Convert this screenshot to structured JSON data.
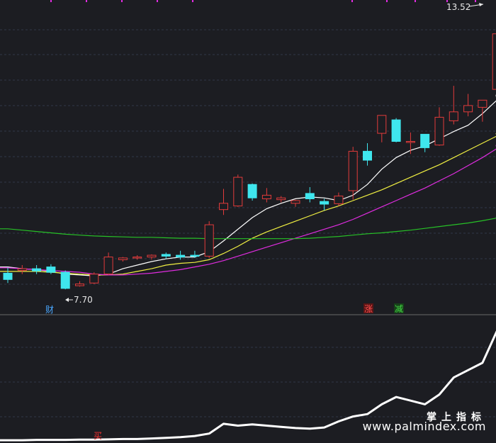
{
  "chart_data": [
    {
      "type": "candlestick",
      "title": "",
      "ylim": [
        7.2,
        14.0
      ],
      "annotations": {
        "high_label": "13.52",
        "low_label": "7.70",
        "marker_cai": "财",
        "marker_zhang": "涨",
        "marker_jian": "减"
      },
      "colors": {
        "up": "#e23b3b",
        "down": "#3fe6ee",
        "bg": "#1c1d22"
      },
      "candles": [
        {
          "o": 8.0,
          "h": 8.12,
          "l": 7.78,
          "c": 7.86
        },
        {
          "o": 8.06,
          "h": 8.18,
          "l": 7.98,
          "c": 8.1
        },
        {
          "o": 8.1,
          "h": 8.18,
          "l": 7.98,
          "c": 8.05
        },
        {
          "o": 8.14,
          "h": 8.2,
          "l": 7.98,
          "c": 8.02
        },
        {
          "o": 8.02,
          "h": 8.06,
          "l": 7.64,
          "c": 7.66
        },
        {
          "o": 7.72,
          "h": 7.82,
          "l": 7.7,
          "c": 7.76
        },
        {
          "o": 7.78,
          "h": 8.02,
          "l": 7.76,
          "c": 7.98
        },
        {
          "o": 7.98,
          "h": 8.46,
          "l": 7.96,
          "c": 8.36
        },
        {
          "o": 8.3,
          "h": 8.36,
          "l": 8.26,
          "c": 8.34
        },
        {
          "o": 8.34,
          "h": 8.4,
          "l": 8.3,
          "c": 8.36
        },
        {
          "o": 8.36,
          "h": 8.42,
          "l": 8.3,
          "c": 8.4
        },
        {
          "o": 8.42,
          "h": 8.46,
          "l": 8.32,
          "c": 8.38
        },
        {
          "o": 8.4,
          "h": 8.5,
          "l": 8.3,
          "c": 8.36
        },
        {
          "o": 8.4,
          "h": 8.5,
          "l": 8.34,
          "c": 8.38
        },
        {
          "o": 8.38,
          "h": 9.16,
          "l": 8.34,
          "c": 9.08
        },
        {
          "o": 9.42,
          "h": 9.88,
          "l": 9.3,
          "c": 9.56
        },
        {
          "o": 9.5,
          "h": 10.2,
          "l": 9.48,
          "c": 10.14
        },
        {
          "o": 9.98,
          "h": 10.0,
          "l": 9.62,
          "c": 9.68
        },
        {
          "o": 9.66,
          "h": 9.9,
          "l": 9.58,
          "c": 9.74
        },
        {
          "o": 9.64,
          "h": 9.72,
          "l": 9.58,
          "c": 9.68
        },
        {
          "o": 9.56,
          "h": 9.64,
          "l": 9.48,
          "c": 9.62
        },
        {
          "o": 9.78,
          "h": 9.92,
          "l": 9.58,
          "c": 9.66
        },
        {
          "o": 9.6,
          "h": 9.66,
          "l": 9.4,
          "c": 9.54
        },
        {
          "o": 9.55,
          "h": 9.8,
          "l": 9.5,
          "c": 9.72
        },
        {
          "o": 9.84,
          "h": 10.82,
          "l": 9.64,
          "c": 10.72
        },
        {
          "o": 10.72,
          "h": 10.9,
          "l": 10.4,
          "c": 10.52
        },
        {
          "o": 11.12,
          "h": 11.32,
          "l": 10.92,
          "c": 11.52
        },
        {
          "o": 11.42,
          "h": 11.46,
          "l": 10.92,
          "c": 10.94
        },
        {
          "o": 10.92,
          "h": 11.14,
          "l": 10.66,
          "c": 10.94
        },
        {
          "o": 11.1,
          "h": 10.92,
          "l": 10.7,
          "c": 10.8
        },
        {
          "o": 10.86,
          "h": 11.7,
          "l": 10.84,
          "c": 11.48
        },
        {
          "o": 11.4,
          "h": 12.18,
          "l": 11.32,
          "c": 11.6
        },
        {
          "o": 11.6,
          "h": 12.0,
          "l": 11.5,
          "c": 11.74
        },
        {
          "o": 11.7,
          "h": 11.86,
          "l": 11.38,
          "c": 11.86
        },
        {
          "o": 12.1,
          "h": 13.52,
          "l": 11.68,
          "c": 13.34
        }
      ],
      "ma": [
        {
          "color": "#ffffff",
          "values": [
            8.14,
            8.1,
            8.08,
            8.04,
            7.98,
            7.96,
            7.94,
            7.98,
            8.1,
            8.18,
            8.26,
            8.32,
            8.36,
            8.36,
            8.48,
            8.72,
            8.98,
            9.24,
            9.44,
            9.56,
            9.66,
            9.7,
            9.68,
            9.62,
            9.74,
            9.98,
            10.32,
            10.58,
            10.74,
            10.84,
            11.0,
            11.16,
            11.3,
            11.56,
            11.86
          ]
        },
        {
          "color": "#f1f042",
          "values": [
            8.04,
            8.04,
            8.04,
            8.02,
            8.0,
            7.98,
            7.96,
            7.96,
            7.98,
            8.04,
            8.1,
            8.18,
            8.22,
            8.24,
            8.3,
            8.44,
            8.6,
            8.78,
            8.92,
            9.04,
            9.16,
            9.28,
            9.4,
            9.5,
            9.62,
            9.74,
            9.86,
            10.0,
            10.14,
            10.28,
            10.42,
            10.58,
            10.74,
            10.9,
            11.06
          ]
        },
        {
          "color": "#e02ce0",
          "values": [
            8.12,
            8.1,
            8.08,
            8.06,
            8.04,
            8.02,
            7.98,
            7.96,
            7.96,
            7.98,
            8.0,
            8.04,
            8.08,
            8.14,
            8.2,
            8.28,
            8.38,
            8.48,
            8.58,
            8.68,
            8.78,
            8.88,
            8.98,
            9.08,
            9.2,
            9.34,
            9.48,
            9.62,
            9.76,
            9.9,
            10.06,
            10.22,
            10.4,
            10.58,
            10.78
          ]
        },
        {
          "color": "#27c127",
          "values": [
            8.99,
            8.96,
            8.93,
            8.9,
            8.87,
            8.85,
            8.83,
            8.82,
            8.81,
            8.8,
            8.8,
            8.79,
            8.78,
            8.78,
            8.77,
            8.77,
            8.77,
            8.77,
            8.77,
            8.77,
            8.77,
            8.78,
            8.8,
            8.82,
            8.85,
            8.88,
            8.9,
            8.93,
            8.96,
            9.0,
            9.04,
            9.08,
            9.12,
            9.17,
            9.23
          ]
        }
      ]
    },
    {
      "type": "line",
      "title": "",
      "ylim": [
        0,
        100
      ],
      "annotations": {
        "marker_mai": "买"
      },
      "series": [
        {
          "color": "#ffffff",
          "values": [
            0.5,
            0.5,
            0.8,
            0.8,
            0.8,
            1.0,
            1.0,
            1.2,
            1.5,
            1.5,
            2.0,
            2.5,
            3.0,
            4.0,
            6.0,
            14.0,
            12.5,
            13.5,
            12.5,
            11.5,
            10.5,
            10.0,
            11.0,
            16.0,
            20.0,
            22.0,
            30.0,
            36.0,
            33.0,
            30.0,
            38.0,
            52.0,
            58.0,
            64.0,
            90.0
          ]
        }
      ]
    }
  ],
  "watermark": {
    "brand": "掌上指标",
    "url": "www.palmindex.com"
  }
}
